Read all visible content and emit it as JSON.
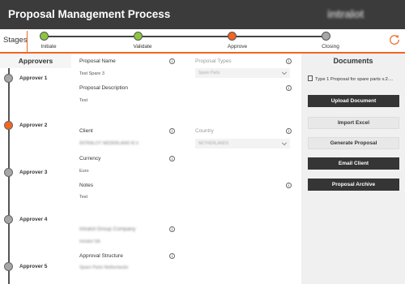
{
  "header": {
    "title": "Proposal Management Process",
    "logo": "intralot"
  },
  "stages": {
    "label": "Stages",
    "items": [
      {
        "label": "Initiate",
        "status": "complete"
      },
      {
        "label": "Validate",
        "status": "complete"
      },
      {
        "label": "Approve",
        "status": "current"
      },
      {
        "label": "Closing",
        "status": "pending"
      }
    ]
  },
  "approvers": {
    "title": "Approvers",
    "items": [
      {
        "label": "Approver 1",
        "status": "pending"
      },
      {
        "label": "Approver 2",
        "status": "current"
      },
      {
        "label": "Approver 3",
        "status": "pending"
      },
      {
        "label": "Approver 4",
        "status": "pending"
      },
      {
        "label": "Approver 5",
        "status": "pending"
      }
    ]
  },
  "form": {
    "proposal_name_label": "Proposal Name",
    "proposal_name_value": "Test Spare 3",
    "proposal_types_label": "Proposal Types",
    "proposal_types_value": "Spare Parts",
    "proposal_description_label": "Proposal Description",
    "proposal_description_value": "Test",
    "client_label": "Client",
    "client_value": "INTRALOT NEDERLAND B.V.",
    "country_label": "Country",
    "country_value": "NETHERLANDS",
    "currency_label": "Currency",
    "currency_value": "Euro",
    "notes_label": "Notes",
    "notes_value": "Test",
    "group_company_label": "Intralot Group Company",
    "group_company_value": "Intralot SA",
    "approval_structure_label": "Approval Structure",
    "approval_structure_value": "Spare Parts Netherlands"
  },
  "documents": {
    "title": "Documents",
    "items": [
      {
        "name": "Type 1 Proposal for spare parts v.2...."
      }
    ],
    "buttons": {
      "upload": "Upload Document",
      "import_excel": "Import Excel",
      "generate": "Generate Proposal",
      "email_client": "Email Client",
      "archive": "Proposal Archive"
    }
  },
  "colors": {
    "accent": "#f26522",
    "complete": "#8cc63f",
    "pending": "#a6a6a6",
    "header_bg": "#3b3b3b"
  }
}
